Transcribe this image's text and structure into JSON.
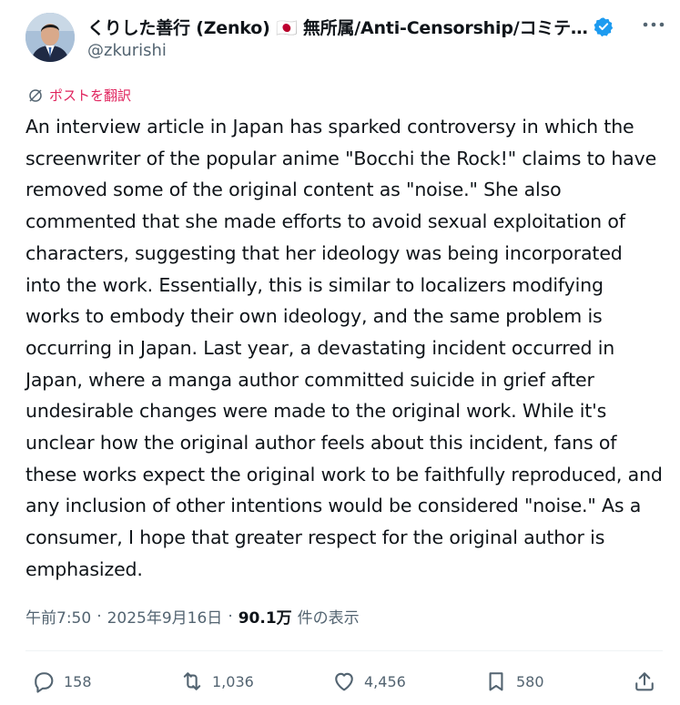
{
  "author": {
    "display_name": "くりした善行 (Zenko) 🇯🇵 無所属/Anti-Censorship/コミテ…",
    "handle": "@zkurishi",
    "verified_icon": "verified-badge-icon",
    "accent_color": "#1d9bf0"
  },
  "translate_label": "ポストを翻訳",
  "post_text": "An interview article in Japan has sparked controversy in which the screenwriter of the popular anime \"Bocchi the Rock!\" claims to have removed some of the original content as \"noise.\" She also commented that she made efforts to avoid sexual exploitation of characters, suggesting that her ideology was being incorporated into the work. Essentially, this is similar to localizers modifying works to embody their own ideology, and the same problem is occurring in Japan. Last year, a devastating incident occurred in Japan, where a manga author committed suicide in grief after undesirable changes were made to the original work. While it's unclear how the original author feels about this incident, fans of these works expect the original work to be faithfully reproduced, and any inclusion of other intentions would be considered \"noise.\" As a consumer, I hope that greater respect for the original author is emphasized.",
  "meta": {
    "time": "午前7:50",
    "separator": "·",
    "date": "2025年9月16日",
    "views_count": "90.1万",
    "views_label": "件の表示"
  },
  "actions": {
    "replies": "158",
    "reposts": "1,036",
    "likes": "4,456",
    "bookmarks": "580"
  }
}
